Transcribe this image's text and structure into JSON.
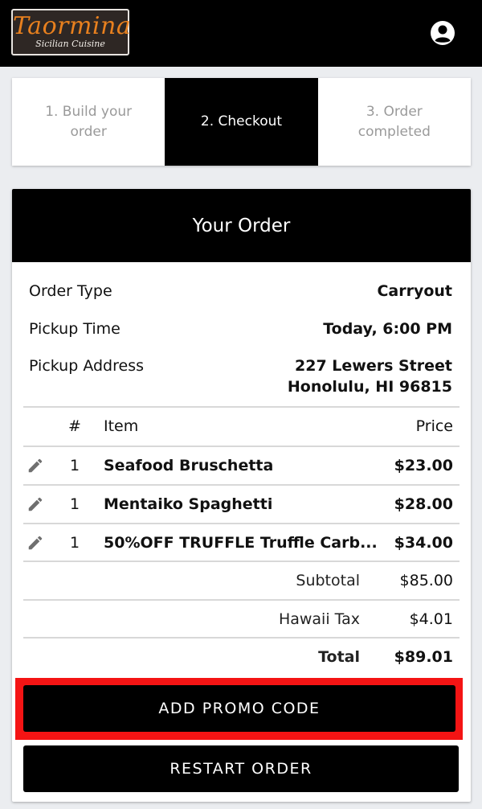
{
  "header": {
    "logo_name": "Taormina",
    "logo_subtitle": "Sicilian Cuisine",
    "account_icon": "account-circle-icon"
  },
  "steps": [
    {
      "label": "1. Build your order",
      "active": false
    },
    {
      "label": "2. Checkout",
      "active": true
    },
    {
      "label": "3. Order completed",
      "active": false
    }
  ],
  "order": {
    "title": "Your Order",
    "type_label": "Order Type",
    "type_value": "Carryout",
    "time_label": "Pickup Time",
    "time_value": "Today, 6:00 PM",
    "address_label": "Pickup Address",
    "address_line1": "227 Lewers Street",
    "address_line2": "Honolulu, HI 96815"
  },
  "table": {
    "headers": {
      "qty": "#",
      "item": "Item",
      "price": "Price"
    },
    "edit_icon": "pencil-icon",
    "rows": [
      {
        "qty": "1",
        "item": "Seafood Bruschetta",
        "price": "$23.00"
      },
      {
        "qty": "1",
        "item": "Mentaiko Spaghetti",
        "price": "$28.00"
      },
      {
        "qty": "1",
        "item": "50%OFF TRUFFLE Truffle Carb...",
        "price": "$34.00"
      }
    ]
  },
  "summary": {
    "subtotal_label": "Subtotal",
    "subtotal_value": "$85.00",
    "tax_label": "Hawaii Tax",
    "tax_value": "$4.01",
    "total_label": "Total",
    "total_value": "$89.01"
  },
  "buttons": {
    "promo": "ADD PROMO CODE",
    "restart": "RESTART ORDER"
  },
  "colors": {
    "highlight": "#f41414",
    "logo_text": "#e8801e"
  }
}
